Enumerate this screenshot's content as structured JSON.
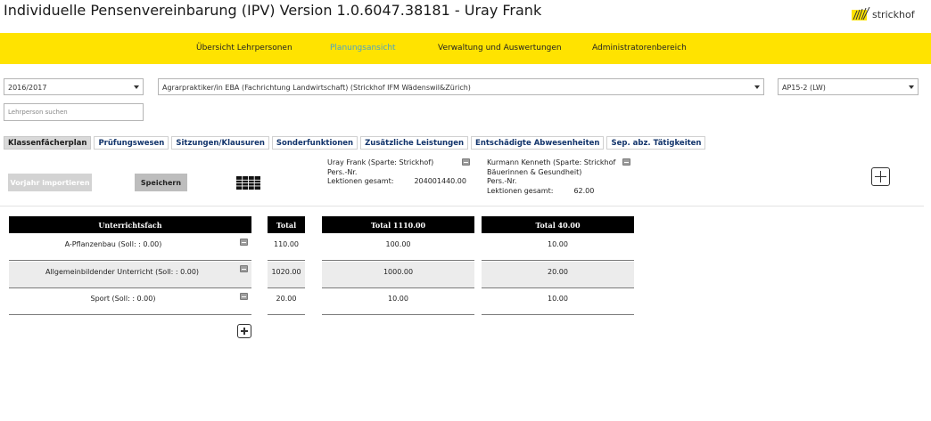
{
  "app": {
    "title": "Individuelle Pensenvereinbarung (IPV) Version 1.0.6047.38181 - Uray Frank",
    "logo_text": "strickhof",
    "brand_color": "#ffe300",
    "active_color": "#4aa3c8"
  },
  "nav": {
    "items": [
      {
        "label": "Übersicht Lehrpersonen"
      },
      {
        "label": "Planungsansicht",
        "active": true
      },
      {
        "label": "Verwaltung und Auswertungen"
      },
      {
        "label": "Administratorenbereich"
      }
    ]
  },
  "filters": {
    "year": "2016/2017",
    "program": "Agrarpraktiker/in EBA (Fachrichtung Landwirtschaft) (Strickhof IFM Wädenswil&Zürich)",
    "class": "AP15-2 (LW)",
    "search_placeholder": "Lehrperson suchen"
  },
  "tabs": [
    {
      "label": "Klassenfächerplan",
      "active": true
    },
    {
      "label": "Prüfungswesen"
    },
    {
      "label": "Sitzungen/Klausuren"
    },
    {
      "label": "Sonderfunktionen"
    },
    {
      "label": "Zusätzliche Leistungen"
    },
    {
      "label": "Entschädigte Abwesenheiten"
    },
    {
      "label": "Sep. abz. Tätigkeiten"
    }
  ],
  "toolbar": {
    "import_label": "Vorjahr importieren",
    "save_label": "Speichern"
  },
  "teachers": [
    {
      "name_line1": "Uray Frank (Sparte: Strickhof)",
      "name_line2": "",
      "pers_nr_label": "Pers.-Nr.",
      "lessons_label": "Lektionen gesamt:",
      "lessons_value": "204001440.00"
    },
    {
      "name_line1": "Kurmann Kenneth (Sparte: Strickhof",
      "name_line2": "Bäuerinnen & Gesundheit)",
      "pers_nr_label": "Pers.-Nr.",
      "lessons_label": "Lektionen gesamt:",
      "lessons_value": "62.00"
    }
  ],
  "table": {
    "header_subject": "Unterrichtsfach",
    "header_total": "Total",
    "header_teacher1": "Total 1110.00",
    "header_teacher2": "Total 40.00",
    "rows": [
      {
        "subject": "A-Pflanzenbau (Soll: : 0.00)",
        "total": "110.00",
        "t1": "100.00",
        "t2": "10.00"
      },
      {
        "subject": "Allgemeinbildender Unterricht (Soll: : 0.00)",
        "total": "1020.00",
        "t1": "1000.00",
        "t2": "20.00"
      },
      {
        "subject": "Sport (Soll: : 0.00)",
        "total": "20.00",
        "t1": "10.00",
        "t2": "10.00"
      }
    ]
  }
}
